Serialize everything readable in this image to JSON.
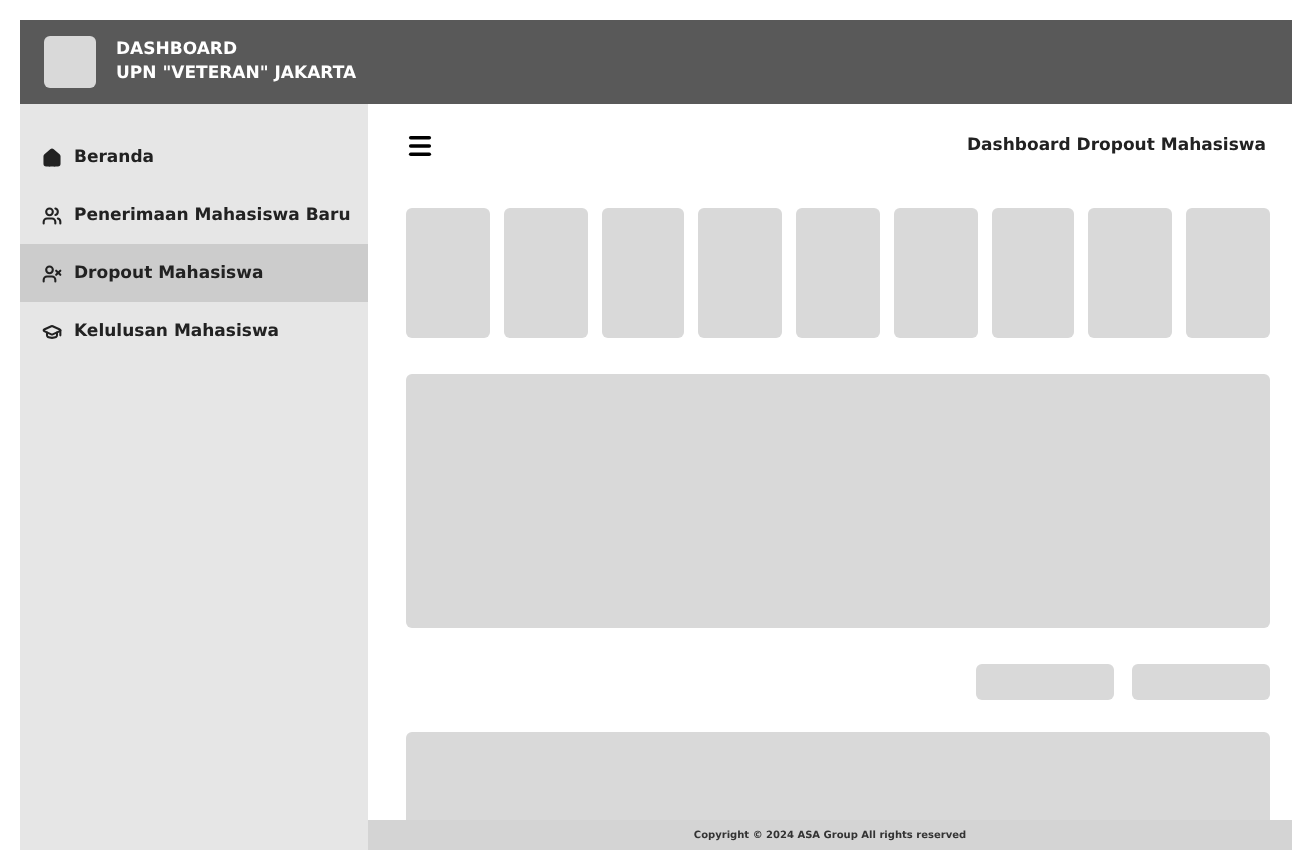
{
  "header": {
    "title": "DASHBOARD",
    "subtitle": "UPN \"VETERAN\" JAKARTA"
  },
  "sidebar": {
    "items": [
      {
        "label": "Beranda",
        "kind": "home",
        "selected": false
      },
      {
        "label": "Penerimaan Mahasiswa Baru",
        "kind": "users",
        "selected": false
      },
      {
        "label": "Dropout Mahasiswa",
        "kind": "dropout",
        "selected": true
      },
      {
        "label": "Kelulusan Mahasiswa",
        "kind": "graduate",
        "selected": false
      }
    ]
  },
  "page_title": "Dashboard Dropout Mahasiswa",
  "stat_cards": [
    {
      "kind": "placeholder"
    },
    {
      "kind": "placeholder"
    },
    {
      "kind": "placeholder"
    },
    {
      "kind": "placeholder"
    },
    {
      "kind": "placeholder"
    },
    {
      "kind": "placeholder"
    },
    {
      "kind": "placeholder"
    },
    {
      "kind": "placeholder"
    },
    {
      "kind": "placeholder"
    }
  ],
  "filter_buttons": [
    {
      "kind": "placeholder"
    },
    {
      "kind": "placeholder"
    }
  ],
  "footer": "Copyright © 2024 ASA Group All rights reserved"
}
